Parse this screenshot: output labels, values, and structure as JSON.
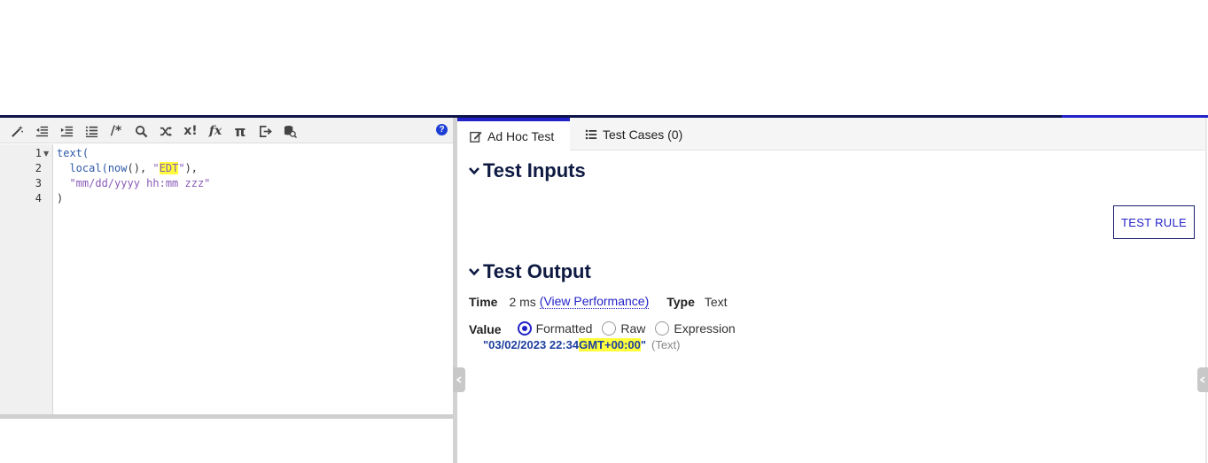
{
  "editor": {
    "toolbar_icons": [
      "wand-icon",
      "outdent-icon",
      "indent-icon",
      "list-icon",
      "comment-icon",
      "search-icon",
      "shuffle-icon",
      "exclamation-icon",
      "function-icon",
      "pi-icon",
      "export-icon",
      "database-search-icon",
      "help-icon"
    ],
    "comment_glyph": "/*",
    "x_glyph": "x!",
    "fx_glyph": "fx",
    "pi_glyph": "π",
    "help_glyph": "?",
    "line_numbers": [
      "1",
      "2",
      "3",
      "4"
    ],
    "code": {
      "line1_fn": "text(",
      "line2_indent": "  ",
      "line2_fn": "local(",
      "line2_inner_fn": "now",
      "line2_punct1": "(), ",
      "line2_quote_open": "\"",
      "line2_highlight": "EDT",
      "line2_quote_close": "\"",
      "line2_punct2": "),",
      "line3_indent": "  ",
      "line3_str": "\"mm/dd/yyyy hh:mm zzz\"",
      "line4": ")"
    }
  },
  "tabs": [
    {
      "label": "Ad Hoc Test",
      "active": true,
      "icon": "edit-icon"
    },
    {
      "label": "Test Cases (0)",
      "active": false,
      "icon": "list-icon"
    }
  ],
  "test_inputs": {
    "title": "Test Inputs"
  },
  "test_rule_button": "TEST RULE",
  "test_output": {
    "title": "Test Output",
    "time_label": "Time",
    "time_value": "2 ms",
    "view_performance": "(View Performance)",
    "type_label": "Type",
    "type_value": "Text",
    "value_label": "Value",
    "radio_options": [
      "Formatted",
      "Raw",
      "Expression"
    ],
    "selected_option": "Formatted",
    "value_prefix": "\"03/02/2023 22:34 ",
    "value_highlight": "GMT+00:00",
    "value_suffix": "\"",
    "value_type": "(Text)"
  },
  "colors": {
    "accent": "#2322c8",
    "navy": "#0e1a42",
    "highlight": "#ffff3c"
  }
}
